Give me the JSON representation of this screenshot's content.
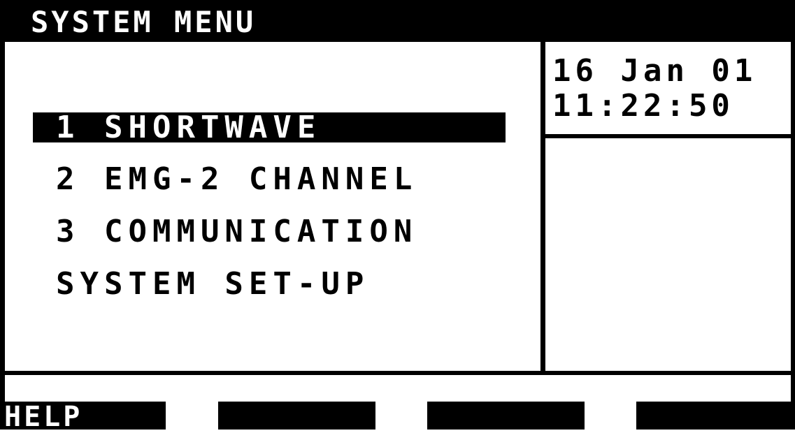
{
  "title": "SYSTEM MENU",
  "datetime": {
    "date": "16 Jan 01",
    "time": "11:22:50"
  },
  "menu": {
    "items": [
      {
        "label": "1 SHORTWAVE",
        "selected": true
      },
      {
        "label": "2 EMG-2 CHANNEL",
        "selected": false
      },
      {
        "label": "3 COMMUNICATION",
        "selected": false
      },
      {
        "label": "SYSTEM SET-UP",
        "selected": false
      }
    ]
  },
  "softkeys": [
    {
      "label": "HELP"
    },
    {
      "label": ""
    },
    {
      "label": ""
    },
    {
      "label": ""
    }
  ],
  "colors": {
    "foreground": "#000000",
    "background": "#ffffff"
  }
}
